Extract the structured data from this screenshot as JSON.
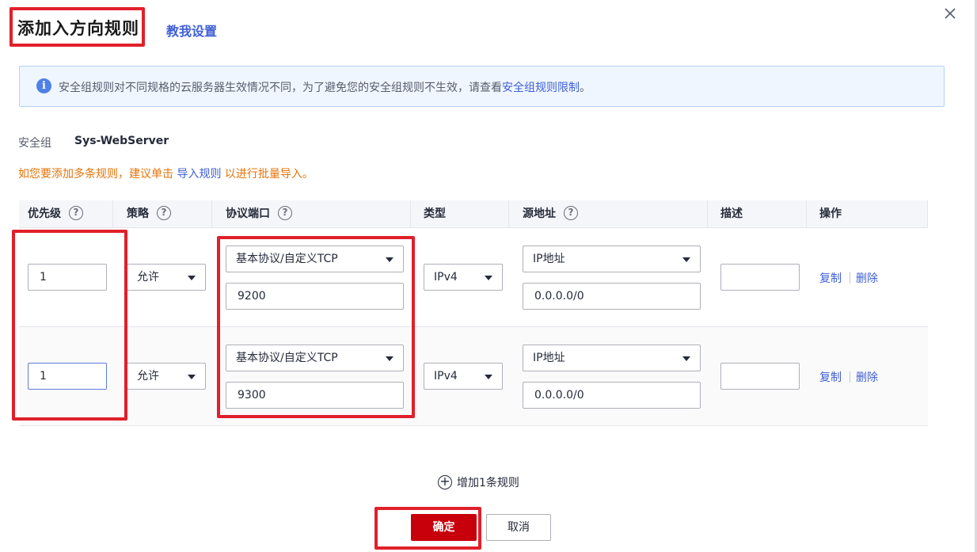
{
  "dialog": {
    "title": "添加入方向规则",
    "teach_link": "教我设置",
    "close_icon": "close-icon"
  },
  "info": {
    "text_prefix": "安全组规则对不同规格的云服务器生效情况不同，为了避免您的安全组规则不生效，请查看",
    "link": "安全组规则限制",
    "text_suffix": "。",
    "icon": "info-icon"
  },
  "security_group": {
    "label": "安全组",
    "value": "Sys-WebServer"
  },
  "hint": {
    "prefix": "如您要添加多条规则，建议单击 ",
    "link": "导入规则",
    "suffix": " 以进行批量导入。"
  },
  "table": {
    "headers": {
      "priority": "优先级",
      "policy": "策略",
      "protocol_port": "协议端口",
      "type": "类型",
      "source": "源地址",
      "description": "描述",
      "actions": "操作"
    },
    "rows": [
      {
        "priority": "1",
        "policy": "允许",
        "protocol": "基本协议/自定义TCP",
        "port": "9200",
        "type": "IPv4",
        "source_type": "IP地址",
        "source_address": "0.0.0.0/0",
        "description": "",
        "copy": "复制",
        "delete": "删除"
      },
      {
        "priority": "1",
        "policy": "允许",
        "protocol": "基本协议/自定义TCP",
        "port": "9300",
        "type": "IPv4",
        "source_type": "IP地址",
        "source_address": "0.0.0.0/0",
        "description": "",
        "copy": "复制",
        "delete": "删除"
      }
    ]
  },
  "footer": {
    "add_rule": "增加1条规则",
    "ok": "确定",
    "cancel": "取消"
  },
  "colors": {
    "primary_red": "#c7000b",
    "link_blue": "#3f5fd6",
    "warning_orange": "#e6730a",
    "highlight_red": "#e0202a"
  }
}
